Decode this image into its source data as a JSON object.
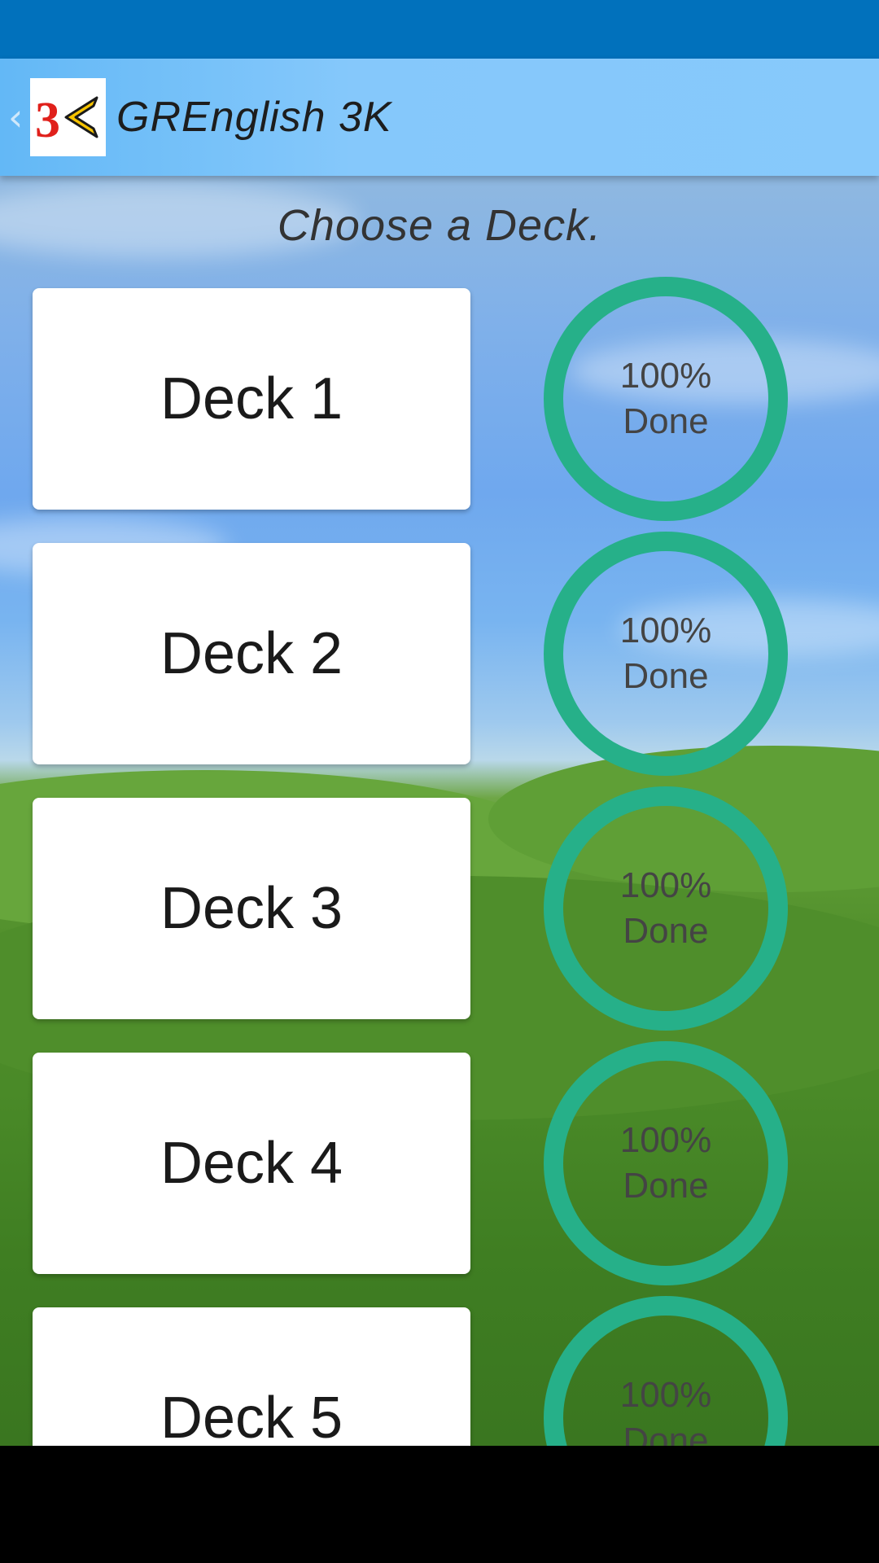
{
  "app": {
    "title": "GREnglish 3K",
    "logo_text": "3K",
    "back_icon": "chevron-left-icon"
  },
  "main": {
    "heading": "Choose a Deck."
  },
  "decks": [
    {
      "label": "Deck 1",
      "progress_percent": 100,
      "progress_line1": "100%",
      "progress_line2": "Done"
    },
    {
      "label": "Deck 2",
      "progress_percent": 100,
      "progress_line1": "100%",
      "progress_line2": "Done"
    },
    {
      "label": "Deck 3",
      "progress_percent": 100,
      "progress_line1": "100%",
      "progress_line2": "Done"
    },
    {
      "label": "Deck 4",
      "progress_percent": 100,
      "progress_line1": "100%",
      "progress_line2": "Done"
    },
    {
      "label": "Deck 5",
      "progress_percent": 100,
      "progress_line1": "100%",
      "progress_line2": "Done"
    }
  ],
  "colors": {
    "status_bar": "#0171bc",
    "app_bar": "#87c9fb",
    "progress_ring": "#26b089",
    "logo_red": "#e0201b",
    "logo_yellow": "#f6c300"
  }
}
